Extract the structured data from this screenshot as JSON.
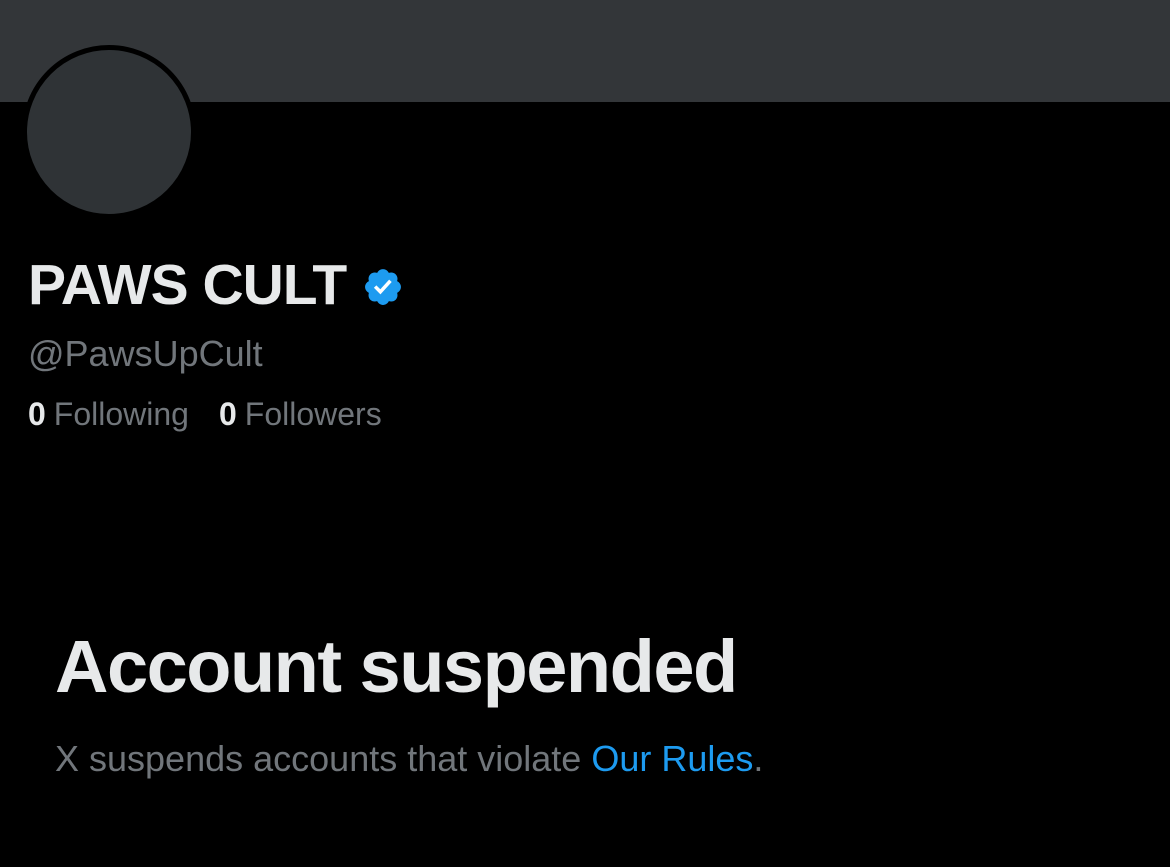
{
  "profile": {
    "display_name": "PAWS CULT",
    "handle": "@PawsUpCult",
    "verified_icon": "verified-badge-icon",
    "following_count": "0",
    "following_label": "Following",
    "followers_count": "0",
    "followers_label": "Followers"
  },
  "suspension": {
    "title": "Account suspended",
    "message_prefix": "X suspends accounts that violate ",
    "rules_link": "Our Rules",
    "message_suffix": "."
  },
  "colors": {
    "background": "#000000",
    "banner": "#333639",
    "avatar": "#2f3336",
    "primary_text": "#e7e9ea",
    "secondary_text": "#71767b",
    "accent": "#1d9bf0"
  }
}
